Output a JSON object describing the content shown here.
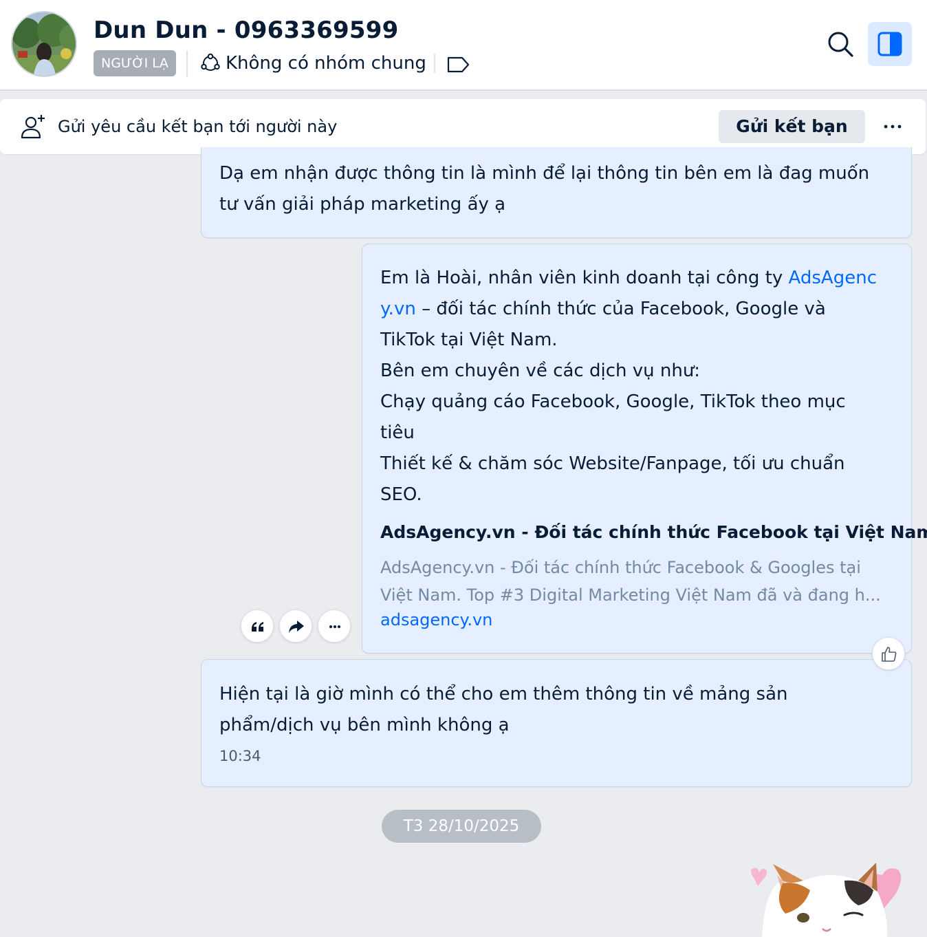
{
  "header": {
    "name": "Dun Dun - 0963369599",
    "badge": "NGƯỜI LẠ",
    "groups_text": "Không có nhóm chung"
  },
  "friend_request": {
    "text": "Gửi yêu cầu kết bạn tới người này",
    "button_label": "Gửi kết bạn"
  },
  "messages": [
    {
      "lines": [
        "Dạ em nhận được thông tin là mình để lại thông tin bên em là đag muốn",
        "tư vấn giải pháp marketing ấy ạ"
      ]
    },
    {
      "line1_prefix": "Em là Hoài, nhân viên kinh doanh tại công ty ",
      "link_part1": "AdsAgenc",
      "link_part2": "y.vn",
      "line2_suffix": " – đối tác chính thức của Facebook, Google và",
      "lines": [
        "TikTok tại Việt Nam.",
        "Bên em chuyên về các dịch vụ như:",
        "Chạy quảng cáo Facebook, Google, TikTok theo mục",
        "tiêu",
        "Thiết kế & chăm sóc Website/Fanpage, tối ưu chuẩn",
        "SEO."
      ],
      "preview": {
        "title": "AdsAgency.vn - Đối tác chính thức Facebook tại Việt Nam",
        "desc_line1": "AdsAgency.vn - Đối tác chính thức Facebook & Googles tại",
        "desc_line2": "Việt Nam. Top #3 Digital Marketing Việt Nam đã và đang h...",
        "domain": "adsagency.vn"
      }
    },
    {
      "lines": [
        "Hiện tại là giờ mình có thể cho em thêm thông tin về mảng sản",
        "phẩm/dịch vụ bên mình không ạ"
      ],
      "time": "10:34"
    }
  ],
  "date_separator": "T3 28/10/2025",
  "colors": {
    "accent": "#0068ff",
    "bubble": "#e5efff",
    "chat_background": "#ebecf0"
  },
  "icons": [
    "search-icon",
    "panel-toggle-icon",
    "group-icon",
    "tag-icon",
    "add-user-icon",
    "more-icon",
    "quote-icon",
    "forward-icon",
    "like-icon"
  ]
}
